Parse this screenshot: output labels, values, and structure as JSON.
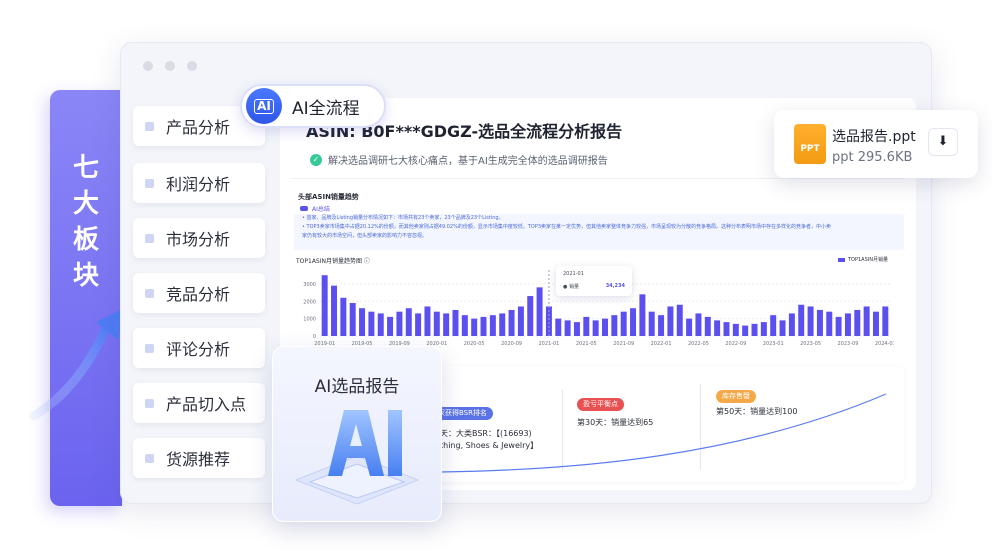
{
  "side_label": [
    "七",
    "大",
    "板",
    "块"
  ],
  "menu": [
    {
      "label": "产品分析"
    },
    {
      "label": "利润分析"
    },
    {
      "label": "市场分析"
    },
    {
      "label": "竞品分析"
    },
    {
      "label": "评论分析"
    },
    {
      "label": "产品切入点"
    },
    {
      "label": "货源推荐"
    }
  ],
  "flow_badge": {
    "icon_text": "AI",
    "label": "AI全流程"
  },
  "report": {
    "title": "ASIN: B0F***GDGZ-选品全流程分析报告",
    "subtitle": "解决选品调研七大核心痛点，基于AI生成完全体的选品调研报告",
    "section_title": "头部ASIN销量趋势",
    "ai_chip": "AI总结",
    "insights": [
      "• 首家、品牌及Listing销量分布情况如下：市场共有23个卖家，23个品牌及23个Listing。",
      "• TOP3卖家市场集中占据20.12%的份额，而其他卖家则占据49.02%的份额，显示市场集中度较低。TOP3卖家在某一定优势，但其他卖家整体竞争力较强，市场呈现较为分散的竞争格局。这种分布表明市场中存在多样化的竞争者，中小卖",
      "家仍有较大的市场空间，但头部卖家的影响力不容忽视。"
    ],
    "chart_caption": "TOP1ASIN月销量趋势图 ⓘ",
    "tooltip": {
      "date": "2021-01",
      "label": "销量",
      "value": "34,234"
    }
  },
  "chart_data": {
    "type": "bar",
    "categories": [
      "2019-01",
      "2019-02",
      "2019-03",
      "2019-04",
      "2019-05",
      "2019-06",
      "2019-07",
      "2019-08",
      "2019-09",
      "2019-10",
      "2019-11",
      "2019-12",
      "2020-01",
      "2020-02",
      "2020-03",
      "2020-04",
      "2020-05",
      "2020-06",
      "2020-07",
      "2020-08",
      "2020-09",
      "2020-10",
      "2020-11",
      "2020-12",
      "2021-01",
      "2021-02",
      "2021-03",
      "2021-04",
      "2021-05",
      "2021-06",
      "2021-07",
      "2021-08",
      "2021-09",
      "2021-10",
      "2021-11",
      "2021-12",
      "2022-01",
      "2022-02",
      "2022-03",
      "2022-04",
      "2022-05",
      "2022-06",
      "2022-07",
      "2022-08",
      "2022-09",
      "2022-10",
      "2022-11",
      "2022-12",
      "2023-01",
      "2023-02",
      "2023-03",
      "2023-04",
      "2023-05",
      "2023-06",
      "2023-07",
      "2023-08",
      "2023-09",
      "2023-10",
      "2023-11",
      "2023-12",
      "2024-01"
    ],
    "tick_labels": [
      "2019-01",
      "2019-05",
      "2019-09",
      "2020-01",
      "2020-05",
      "2020-09",
      "2021-01",
      "2021-05",
      "2021-09",
      "2022-01",
      "2022-05",
      "2022-09",
      "2023-01",
      "2023-05",
      "2023-09",
      "2024-01"
    ],
    "series": [
      {
        "name": "TOP1ASIN月销量",
        "values": [
          3500,
          2900,
          2200,
          1900,
          1600,
          1400,
          1300,
          1100,
          1400,
          1600,
          1300,
          1700,
          1400,
          1300,
          1500,
          1200,
          1000,
          1100,
          1200,
          1300,
          1500,
          1700,
          2300,
          2800,
          1700,
          1000,
          900,
          800,
          1100,
          900,
          1000,
          1200,
          1400,
          1600,
          2400,
          1400,
          1200,
          1700,
          1800,
          1000,
          1300,
          1100,
          900,
          800,
          700,
          600,
          700,
          800,
          1200,
          900,
          1300,
          1800,
          1700,
          1500,
          1400,
          1100,
          1300,
          1500,
          1700,
          1400,
          1700
        ]
      }
    ],
    "yticks": [
      0,
      1000,
      2000,
      3000
    ],
    "ylim": [
      0,
      3800
    ],
    "grid": true,
    "legend_position": "top-right"
  },
  "milestones": {
    "bsr_pill": "家获得BSR排名",
    "bsr_line1": "天：大类BSR：【(16693)",
    "bsr_line2": "thing, Shoes & Jewelry】",
    "break_pill": "盈亏平衡点",
    "break_text": "第30天：销量达到65",
    "stock_pill": "库存售罄",
    "stock_text": "第50天：销量达到100"
  },
  "ai_card": {
    "title": "AI选品报告"
  },
  "file": {
    "name": "选品报告.ppt",
    "meta": "ppt 295.6KB",
    "icon_text": "PPT"
  },
  "colors": {
    "accent": "#5b4ff0",
    "strip": "#7a74f3",
    "break": "#e85151",
    "stock": "#f3a94a",
    "bsr": "#5b73e8"
  }
}
